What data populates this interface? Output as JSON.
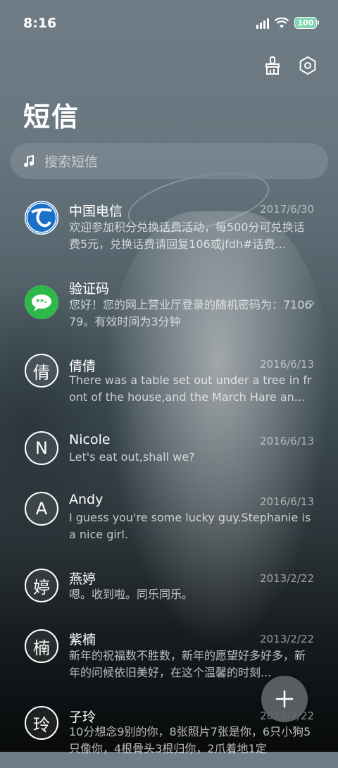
{
  "status_bar": {
    "time": "8:16",
    "battery": "100"
  },
  "header": {
    "title": "短信"
  },
  "search": {
    "placeholder": "搜索短信"
  },
  "conversations": [
    {
      "name": "中国电信",
      "date": "2017/6/30",
      "preview": "欢迎参加积分兑换话费活动，每500分可兑换话费5元，兑换话费请回复106或jfdh#话费...",
      "avatar_type": "telecom-logo"
    },
    {
      "name": "验证码",
      "date": "",
      "preview": "您好！您的网上营业厅登录的随机密码为：710679。有效时间为3分钟",
      "avatar_type": "green-chat"
    },
    {
      "name": "倩倩",
      "date": "2016/6/13",
      "preview": "There was a table set out under a tree in front of the house,and the March Hare an...",
      "avatar_letter": "倩"
    },
    {
      "name": "Nicole",
      "date": "2016/6/13",
      "preview": "Let's eat out,shall we?",
      "avatar_letter": "N"
    },
    {
      "name": "Andy",
      "date": "2016/6/13",
      "preview": "I guess you're some lucky guy.Stephanie is a nice girl.",
      "avatar_letter": "A"
    },
    {
      "name": "燕婷",
      "date": "2013/2/22",
      "preview": "嗯。收到啦。同乐同乐。",
      "avatar_letter": "婷"
    },
    {
      "name": "紫楠",
      "date": "2013/2/22",
      "preview": "新年的祝福数不胜数，新年的愿望好多好多，新年的问候依旧美好，在这个温馨的时刻...",
      "avatar_letter": "楠"
    },
    {
      "name": "子玲",
      "date": "2013/2/22",
      "preview": "10分想念9别的你，8张照片7张是你，6只小狗5只像你，4根骨头3根归你，2爪着地1定",
      "avatar_letter": "玲"
    }
  ],
  "fab": {
    "icon": "plus-icon"
  },
  "actions": {
    "clean_icon": "brush-icon",
    "settings_icon": "gear-icon"
  }
}
